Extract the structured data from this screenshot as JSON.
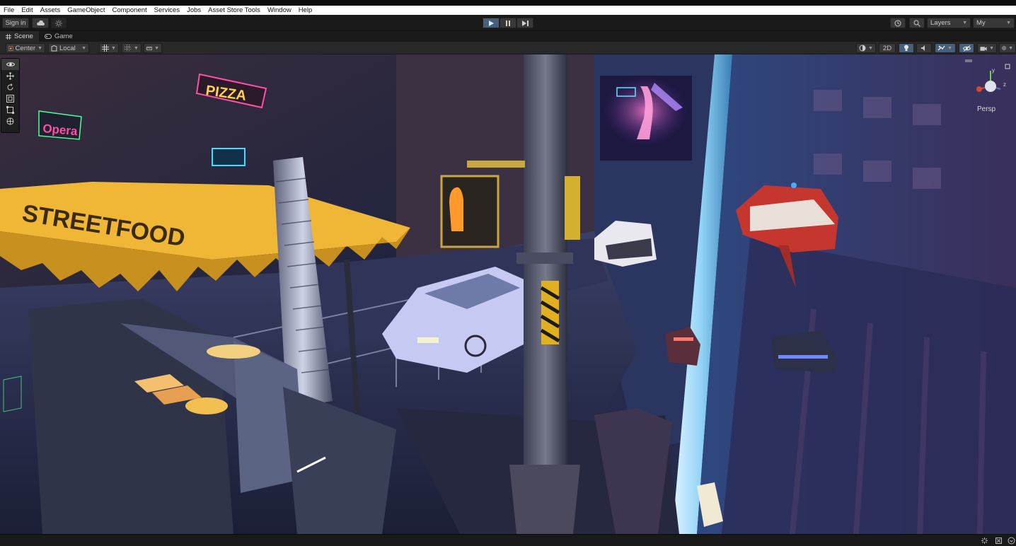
{
  "menu": [
    "File",
    "Edit",
    "Assets",
    "GameObject",
    "Component",
    "Services",
    "Jobs",
    "Asset Store Tools",
    "Window",
    "Help"
  ],
  "toolbar": {
    "sign_in": "Sign in",
    "layers": "Layers",
    "layout": "My"
  },
  "tabs": [
    {
      "label": "Scene",
      "active": true
    },
    {
      "label": "Game",
      "active": false
    }
  ],
  "scene_toolbar": {
    "pivot_mode": "Center",
    "pivot_rotation": "Local",
    "mode_2d": "2D"
  },
  "scene": {
    "gizmo_projection": "Persp",
    "signs": [
      "PIZZA",
      "Opera",
      "STREETFOOD"
    ]
  },
  "colors": {
    "play_active": "#46607c",
    "neon_pink": "#ff4fa6",
    "neon_cyan": "#3fe0ff",
    "awning_yellow": "#f0b636"
  }
}
